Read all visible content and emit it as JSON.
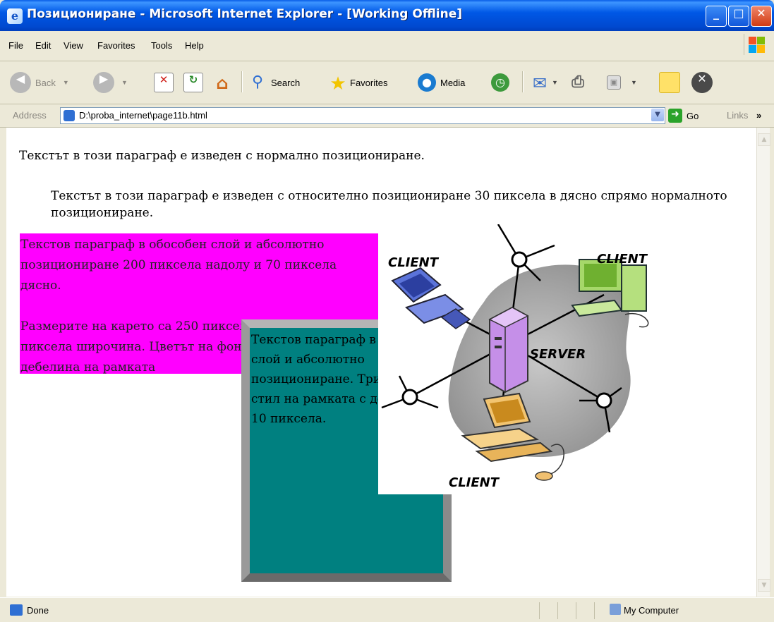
{
  "window": {
    "title": "Позициониране - Microsoft Internet Explorer - [Working Offline]",
    "minimize": "_",
    "maximize": "□",
    "close": "✕"
  },
  "menu": [
    "File",
    "Edit",
    "View",
    "Favorites",
    "Tools",
    "Help"
  ],
  "toolbar": {
    "back": "Back",
    "search": "Search",
    "favorites": "Favorites",
    "media": "Media"
  },
  "address": {
    "label": "Address",
    "url": "D:\\proba_internet\\page11b.html",
    "go": "Go",
    "links": "Links",
    "links_chevron": "»"
  },
  "page": {
    "p1": "Текстът в този параграф е изведен с нормално позициониране.",
    "p2": "Текстът в този параграф е изведен с относително позициониране 30 пиксела в дясно спрямо нормалното позициониране.",
    "magenta_1": "Текстов параграф в обособен слой и абсолютно позициониране 200 пиксела надолу и 70 пиксела дясно.",
    "magenta_2": "Размерите на карето са 250 пиксела височина и 200 пиксела широчина. Цветът на фона е магента с дебелина на рамката",
    "teal": "Текстов параграф в обособен слой и абсолютно позициониране. Тримерен стил на рамката с дебелина 10 пиксела."
  },
  "diagram": {
    "client_tl": "CLIENT",
    "client_tr": "CLIENT",
    "client_b": "CLIENT",
    "server": "SERVER"
  },
  "status": {
    "text": "Done",
    "zone": "My Computer"
  },
  "colors": {
    "magenta": "#ff00ff",
    "teal": "#008080",
    "xp_blue": "#0058e6"
  }
}
